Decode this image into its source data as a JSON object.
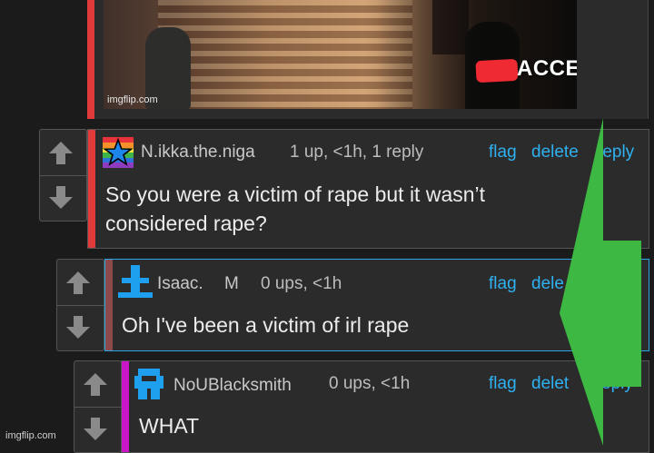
{
  "meme": {
    "caption": "ACCEPTABLE",
    "watermark": "imgflip.com"
  },
  "comments": [
    {
      "username": "N.ikka.the.niga",
      "meta": "1 up, <1h, 1 reply",
      "text_line1": "So you were a victim of rape but it wasn’t",
      "text_line2": "considered rape?",
      "flag": "flag",
      "delete": "delete",
      "reply": "reply",
      "bar_color": "#e03a3a"
    },
    {
      "username": "Isaac.",
      "badge": "M",
      "meta": "0 ups, <1h",
      "text": "Oh I've been a victim of irl rape",
      "flag": "flag",
      "delete": "dele",
      "bar_color": "#8c4a4a"
    },
    {
      "username": "NoUBlacksmith",
      "meta": "0 ups, <1h",
      "text": "WHAT",
      "flag": "flag",
      "delete": "delet",
      "reply": "eply",
      "bar_color": "#c816c8"
    }
  ],
  "overlay": {
    "arrow_color": "#3db842"
  },
  "watermark": "imgflip.com"
}
